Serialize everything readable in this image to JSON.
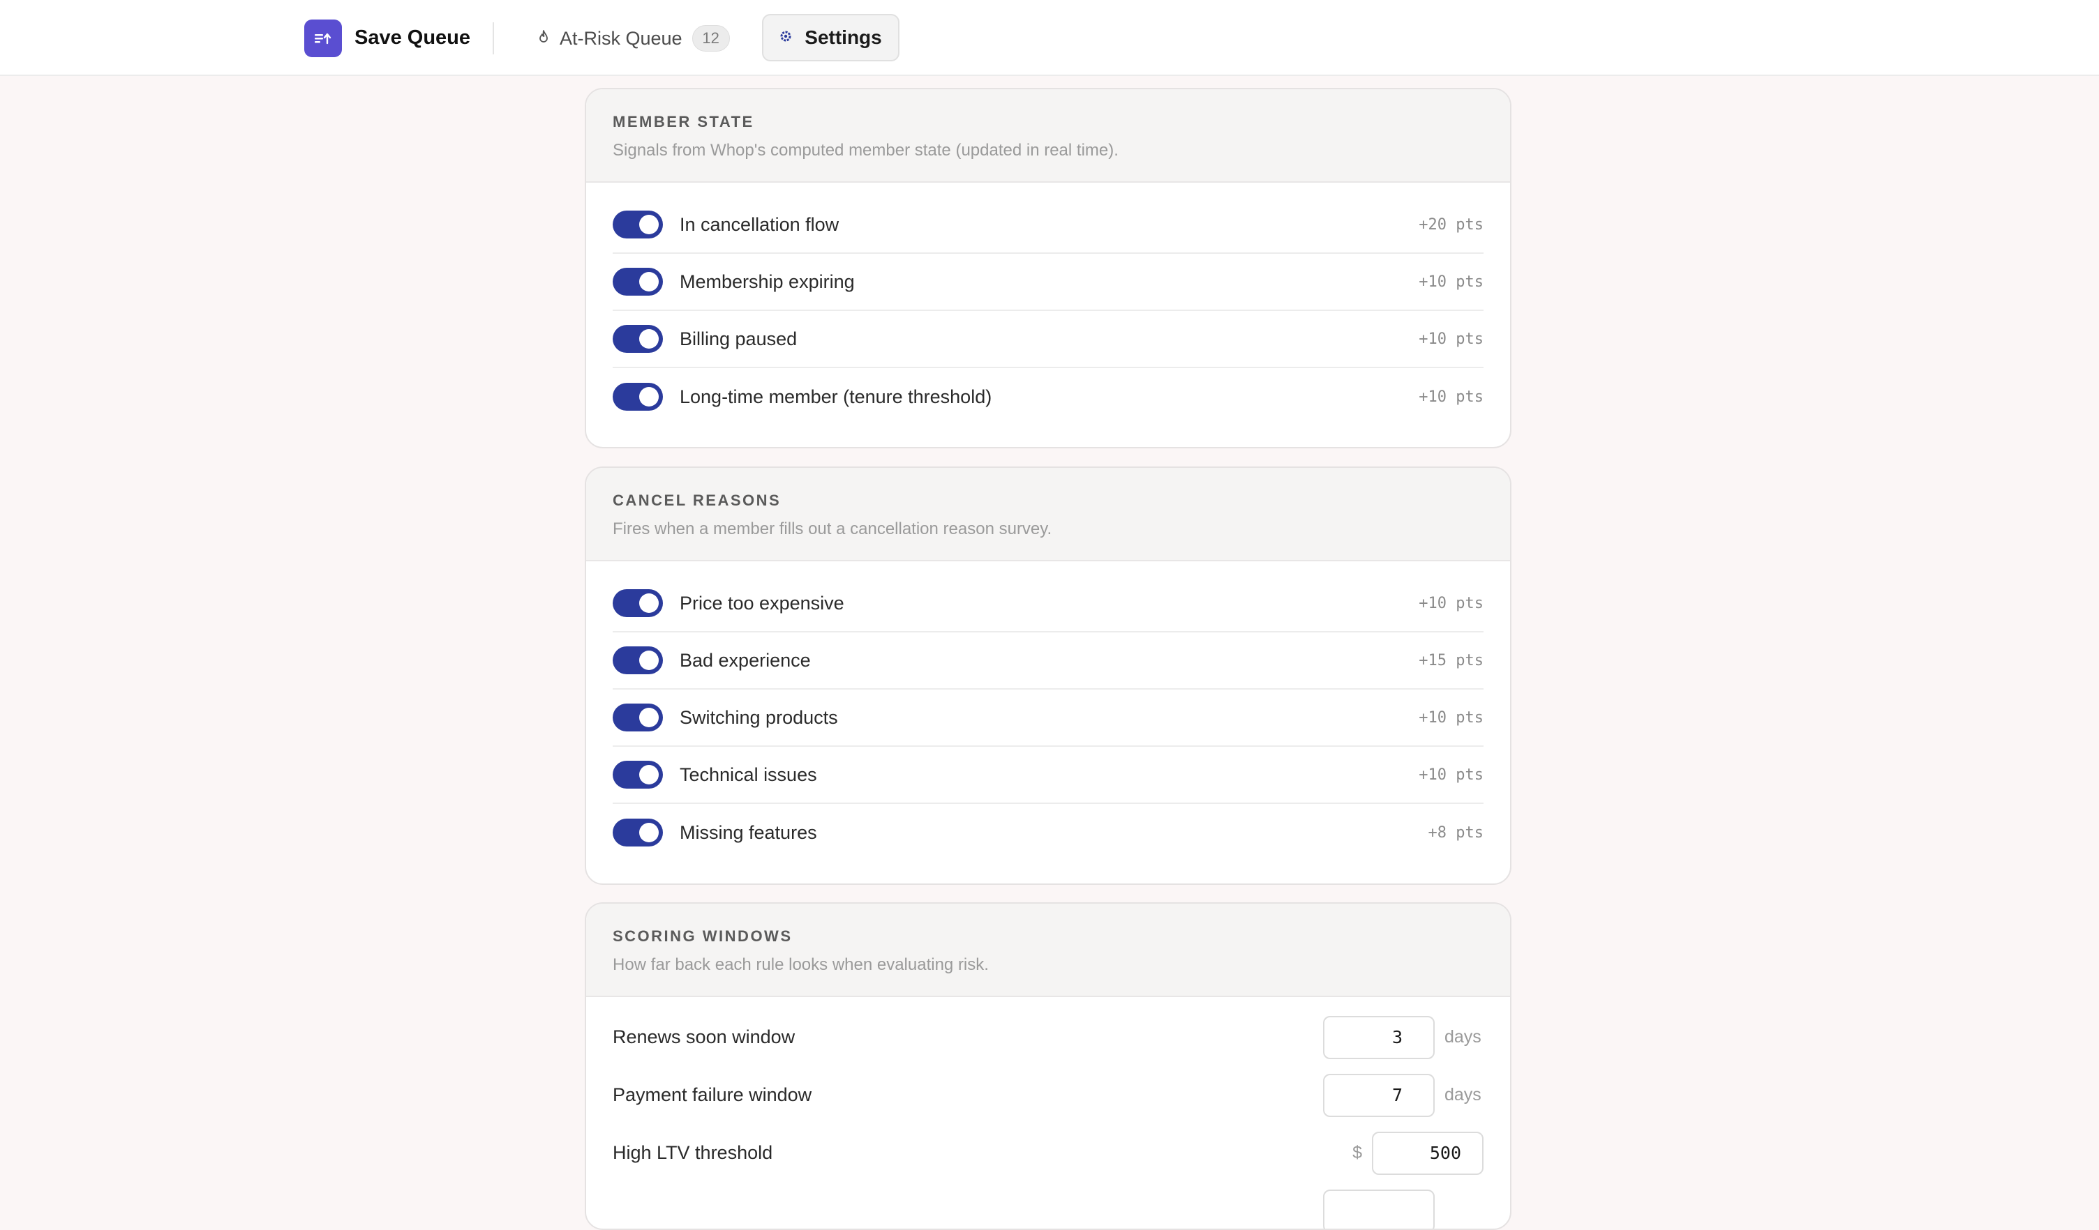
{
  "header": {
    "brand": "Save Queue",
    "nav": {
      "at_risk_label": "At-Risk Queue",
      "at_risk_count": "12",
      "settings_label": "Settings"
    }
  },
  "member_state": {
    "title": "MEMBER STATE",
    "description": "Signals from Whop's computed member state (updated in real time).",
    "rules": [
      {
        "label": "In cancellation flow",
        "points": "+20 pts",
        "enabled": true
      },
      {
        "label": "Membership expiring",
        "points": "+10 pts",
        "enabled": true
      },
      {
        "label": "Billing paused",
        "points": "+10 pts",
        "enabled": true
      },
      {
        "label": "Long-time member (tenure threshold)",
        "points": "+10 pts",
        "enabled": true
      }
    ]
  },
  "cancel_reasons": {
    "title": "CANCEL REASONS",
    "description": "Fires when a member fills out a cancellation reason survey.",
    "rules": [
      {
        "label": "Price too expensive",
        "points": "+10 pts",
        "enabled": true
      },
      {
        "label": "Bad experience",
        "points": "+15 pts",
        "enabled": true
      },
      {
        "label": "Switching products",
        "points": "+10 pts",
        "enabled": true
      },
      {
        "label": "Technical issues",
        "points": "+10 pts",
        "enabled": true
      },
      {
        "label": "Missing features",
        "points": "+8 pts",
        "enabled": true
      }
    ]
  },
  "scoring_windows": {
    "title": "SCORING WINDOWS",
    "description": "How far back each rule looks when evaluating risk.",
    "fields": [
      {
        "label": "Renews soon window",
        "value": "3",
        "unit": "days"
      },
      {
        "label": "Payment failure window",
        "value": "7",
        "unit": "days"
      },
      {
        "label": "High LTV threshold",
        "value": "500",
        "prefix": "$"
      }
    ]
  },
  "colors": {
    "toggle_on": "#2b3b9c",
    "brand_logo": "#5a4ed1"
  }
}
